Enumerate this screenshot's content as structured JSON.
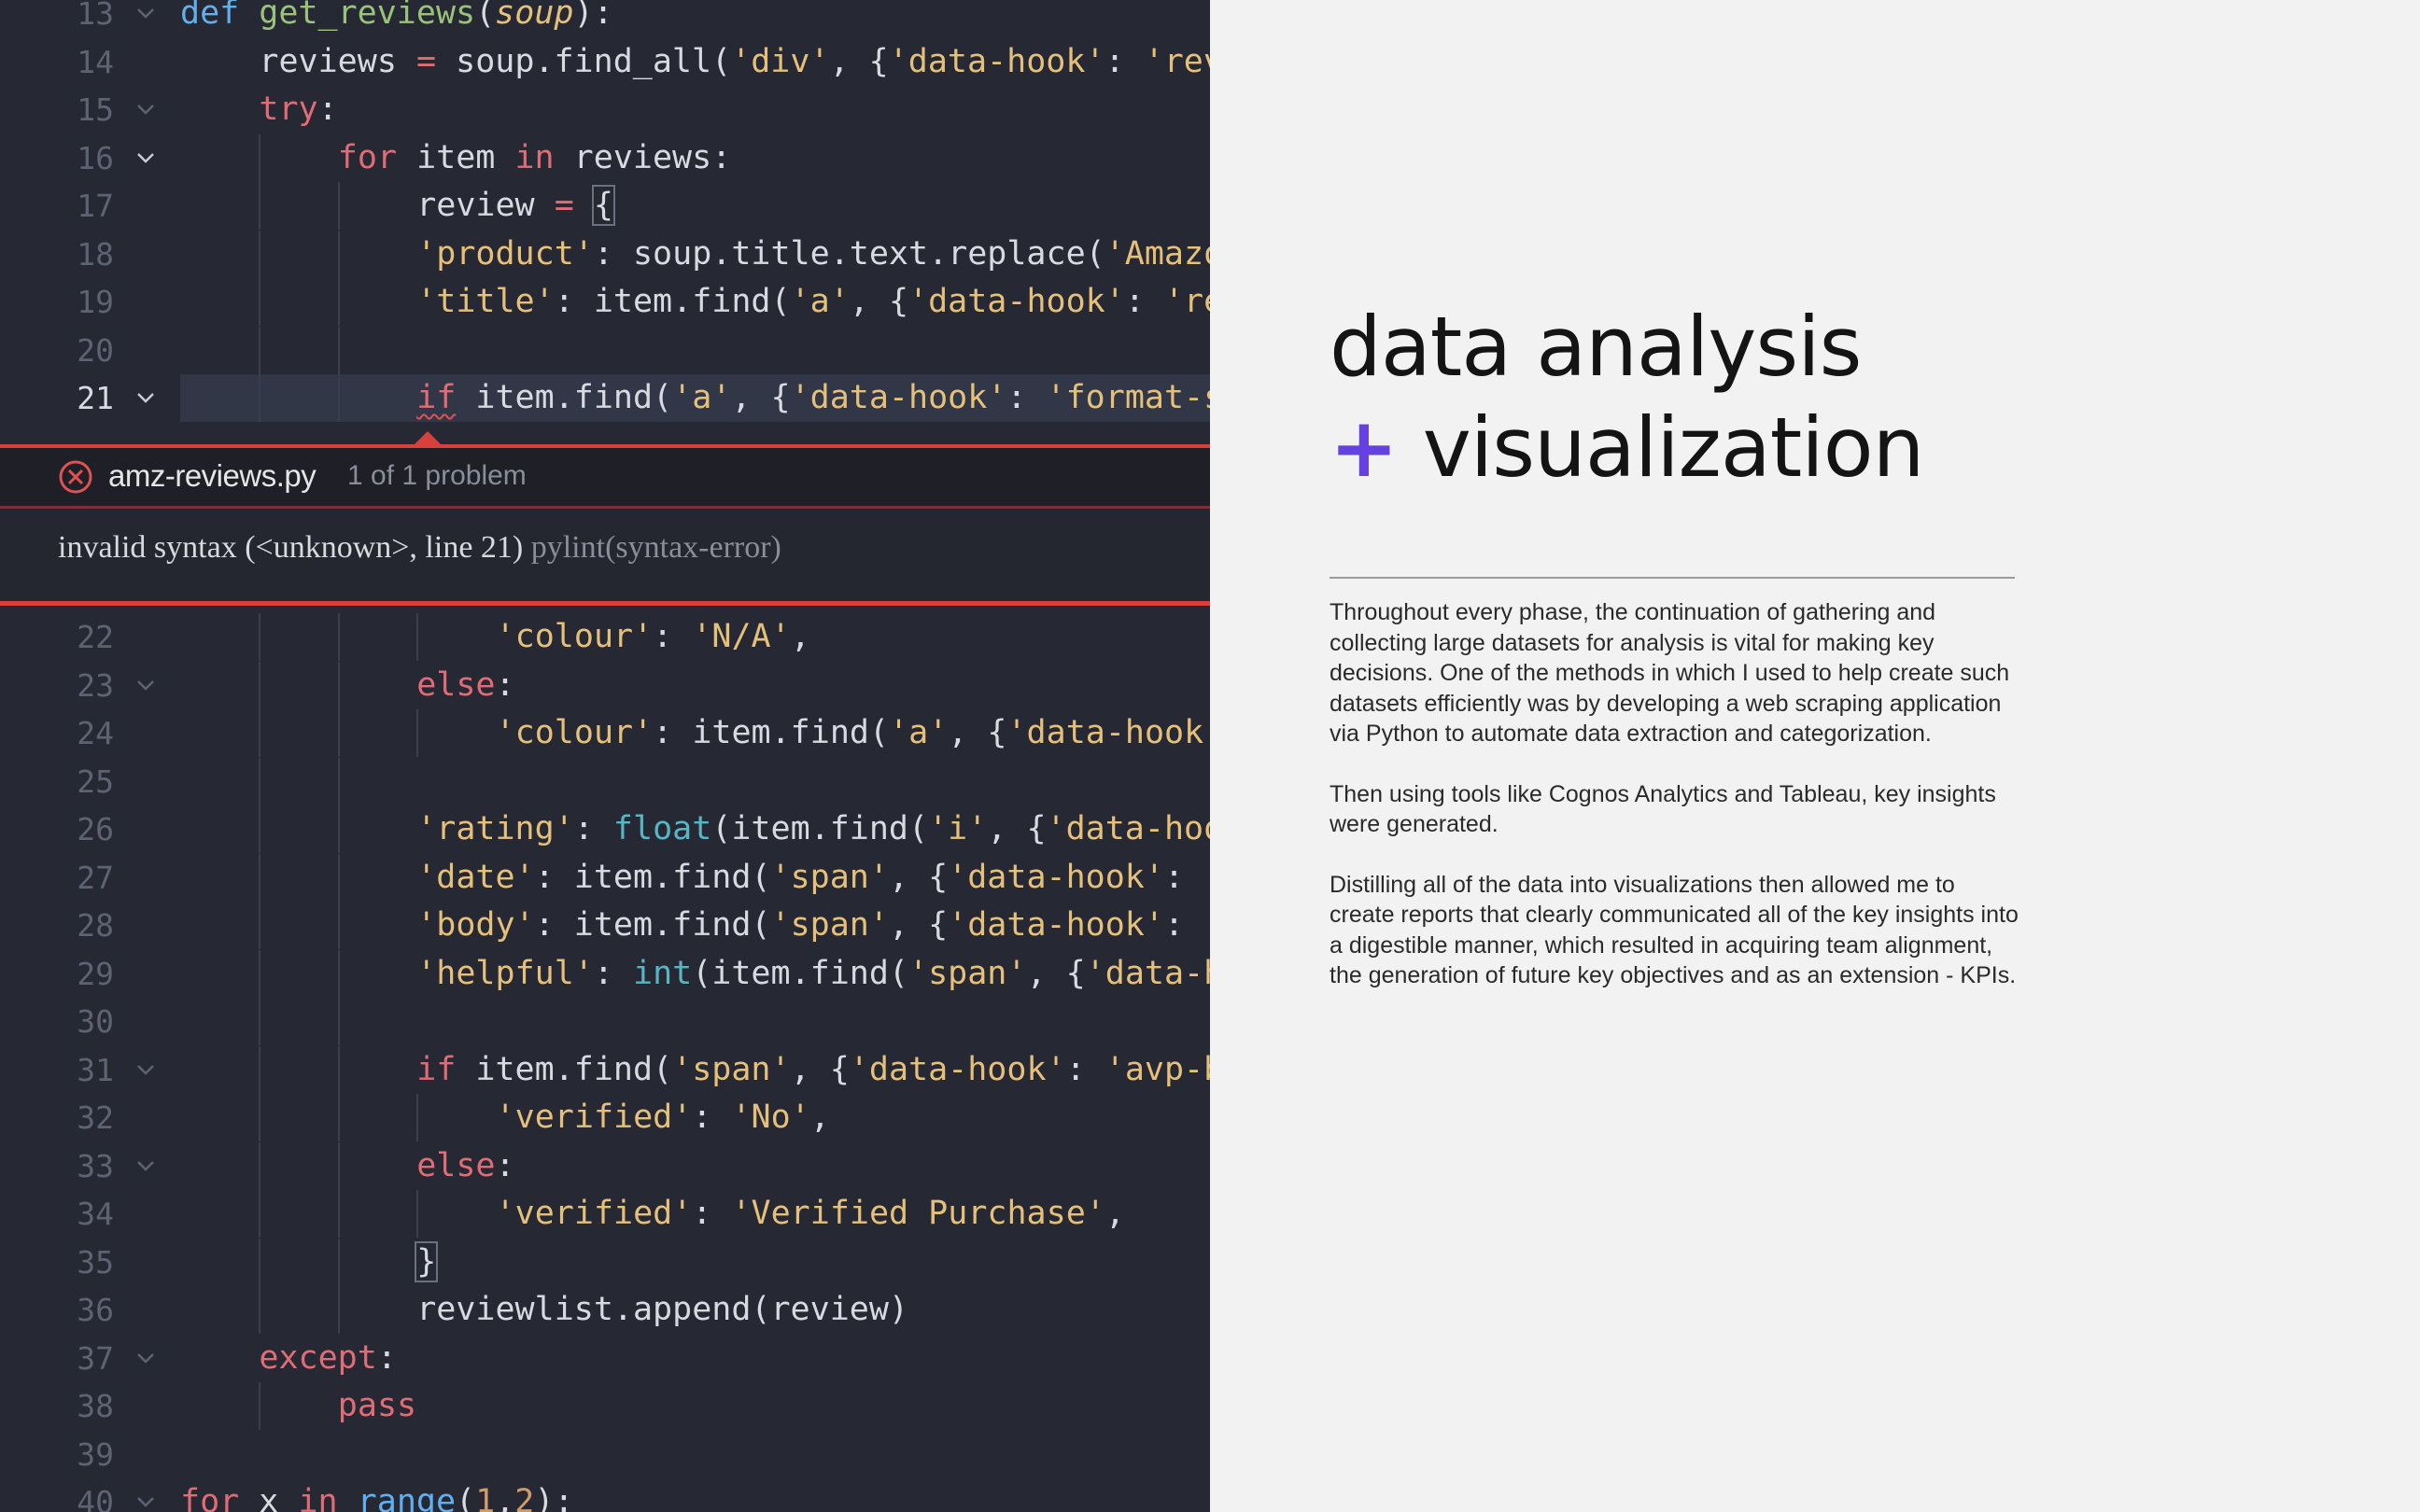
{
  "editor": {
    "lines_before": [
      {
        "n": "13",
        "fold": true,
        "indent": 0,
        "tokens": [
          [
            "kw-def",
            "def "
          ],
          [
            "fn",
            "get_reviews"
          ],
          [
            "pl",
            "("
          ],
          [
            "par",
            "soup"
          ],
          [
            "pl",
            "):"
          ]
        ]
      },
      {
        "n": "14",
        "fold": false,
        "indent": 1,
        "tokens": [
          [
            "pl",
            "reviews "
          ],
          [
            "op",
            "="
          ],
          [
            "pl",
            " soup.find_all("
          ],
          [
            "str",
            "'div'"
          ],
          [
            "pl",
            ", {"
          ],
          [
            "str",
            "'data-hook'"
          ],
          [
            "pl",
            ": "
          ],
          [
            "str",
            "'rev"
          ]
        ]
      },
      {
        "n": "15",
        "fold": true,
        "indent": 1,
        "tokens": [
          [
            "kw",
            "try"
          ],
          [
            "pl",
            ":"
          ]
        ]
      },
      {
        "n": "16",
        "fold": true,
        "indent": 2,
        "tokens": [
          [
            "kw",
            "for"
          ],
          [
            "pl",
            " item "
          ],
          [
            "kw",
            "in"
          ],
          [
            "pl",
            " reviews:"
          ]
        ]
      },
      {
        "n": "17",
        "fold": false,
        "indent": 3,
        "tokens": [
          [
            "pl",
            "review "
          ],
          [
            "op",
            "="
          ],
          [
            "pl",
            " "
          ],
          [
            "box",
            "{"
          ]
        ]
      },
      {
        "n": "18",
        "fold": false,
        "indent": 3,
        "tokens": [
          [
            "str",
            "'product'"
          ],
          [
            "pl",
            ": soup.title.text.replace("
          ],
          [
            "str",
            "'Amazo"
          ]
        ]
      },
      {
        "n": "19",
        "fold": false,
        "indent": 3,
        "tokens": [
          [
            "str",
            "'title'"
          ],
          [
            "pl",
            ": item.find("
          ],
          [
            "str",
            "'a'"
          ],
          [
            "pl",
            ", {"
          ],
          [
            "str",
            "'data-hook'"
          ],
          [
            "pl",
            ": "
          ],
          [
            "str",
            "'re"
          ]
        ]
      },
      {
        "n": "20",
        "fold": false,
        "indent": 3,
        "tokens": []
      },
      {
        "n": "21",
        "fold": true,
        "indent": 3,
        "current": true,
        "tokens": [
          [
            "squig",
            "if"
          ],
          [
            "pl",
            " item.find("
          ],
          [
            "str",
            "'a'"
          ],
          [
            "pl",
            ", {"
          ],
          [
            "str",
            "'data-hook'"
          ],
          [
            "pl",
            ": "
          ],
          [
            "str",
            "'format-s"
          ]
        ]
      }
    ],
    "lines_after": [
      {
        "n": "22",
        "fold": false,
        "indent": 4,
        "tokens": [
          [
            "str",
            "'colour'"
          ],
          [
            "pl",
            ": "
          ],
          [
            "str",
            "'N/A'"
          ],
          [
            "pl",
            ","
          ]
        ]
      },
      {
        "n": "23",
        "fold": true,
        "indent": 3,
        "tokens": [
          [
            "kw",
            "else"
          ],
          [
            "pl",
            ":"
          ]
        ]
      },
      {
        "n": "24",
        "fold": false,
        "indent": 4,
        "tokens": [
          [
            "str",
            "'colour'"
          ],
          [
            "pl",
            ": item.find("
          ],
          [
            "str",
            "'a'"
          ],
          [
            "pl",
            ", {"
          ],
          [
            "str",
            "'data-hook'"
          ]
        ]
      },
      {
        "n": "25",
        "fold": false,
        "indent": 3,
        "tokens": []
      },
      {
        "n": "26",
        "fold": false,
        "indent": 3,
        "tokens": [
          [
            "str",
            "'rating'"
          ],
          [
            "pl",
            ": "
          ],
          [
            "bi",
            "float"
          ],
          [
            "pl",
            "(item.find("
          ],
          [
            "str",
            "'i'"
          ],
          [
            "pl",
            ", {"
          ],
          [
            "str",
            "'data-hoo"
          ]
        ]
      },
      {
        "n": "27",
        "fold": false,
        "indent": 3,
        "tokens": [
          [
            "str",
            "'date'"
          ],
          [
            "pl",
            ": item.find("
          ],
          [
            "str",
            "'span'"
          ],
          [
            "pl",
            ", {"
          ],
          [
            "str",
            "'data-hook'"
          ],
          [
            "pl",
            ": "
          ],
          [
            "str",
            "'"
          ]
        ]
      },
      {
        "n": "28",
        "fold": false,
        "indent": 3,
        "tokens": [
          [
            "str",
            "'body'"
          ],
          [
            "pl",
            ": item.find("
          ],
          [
            "str",
            "'span'"
          ],
          [
            "pl",
            ", {"
          ],
          [
            "str",
            "'data-hook'"
          ],
          [
            "pl",
            ": "
          ],
          [
            "str",
            "'"
          ]
        ]
      },
      {
        "n": "29",
        "fold": false,
        "indent": 3,
        "tokens": [
          [
            "str",
            "'helpful'"
          ],
          [
            "pl",
            ": "
          ],
          [
            "bi",
            "int"
          ],
          [
            "pl",
            "(item.find("
          ],
          [
            "str",
            "'span'"
          ],
          [
            "pl",
            ", {"
          ],
          [
            "str",
            "'data-h"
          ]
        ]
      },
      {
        "n": "30",
        "fold": false,
        "indent": 3,
        "tokens": []
      },
      {
        "n": "31",
        "fold": true,
        "indent": 3,
        "tokens": [
          [
            "kw",
            "if"
          ],
          [
            "pl",
            " item.find("
          ],
          [
            "str",
            "'span'"
          ],
          [
            "pl",
            ", {"
          ],
          [
            "str",
            "'data-hook'"
          ],
          [
            "pl",
            ": "
          ],
          [
            "str",
            "'avp-b"
          ]
        ]
      },
      {
        "n": "32",
        "fold": false,
        "indent": 4,
        "tokens": [
          [
            "str",
            "'verified'"
          ],
          [
            "pl",
            ": "
          ],
          [
            "str",
            "'No'"
          ],
          [
            "pl",
            ","
          ]
        ]
      },
      {
        "n": "33",
        "fold": true,
        "indent": 3,
        "tokens": [
          [
            "kw",
            "else"
          ],
          [
            "pl",
            ":"
          ]
        ]
      },
      {
        "n": "34",
        "fold": false,
        "indent": 4,
        "tokens": [
          [
            "str",
            "'verified'"
          ],
          [
            "pl",
            ": "
          ],
          [
            "str",
            "'Verified Purchase'"
          ],
          [
            "pl",
            ","
          ]
        ]
      },
      {
        "n": "35",
        "fold": false,
        "indent": 3,
        "tokens": [
          [
            "box",
            "}"
          ]
        ]
      },
      {
        "n": "36",
        "fold": false,
        "indent": 3,
        "tokens": [
          [
            "pl",
            "reviewlist.append(review)"
          ]
        ]
      },
      {
        "n": "37",
        "fold": true,
        "indent": 1,
        "tokens": [
          [
            "kw",
            "except"
          ],
          [
            "pl",
            ":"
          ]
        ]
      },
      {
        "n": "38",
        "fold": false,
        "indent": 2,
        "tokens": [
          [
            "kw",
            "pass"
          ]
        ]
      },
      {
        "n": "39",
        "fold": false,
        "indent": 0,
        "tokens": []
      },
      {
        "n": "40",
        "fold": true,
        "indent": 0,
        "tokens": [
          [
            "kw",
            "for"
          ],
          [
            "pl",
            " x "
          ],
          [
            "kw",
            "in"
          ],
          [
            "pl",
            " "
          ],
          [
            "def",
            "range"
          ],
          [
            "pl",
            "("
          ],
          [
            "num",
            "1"
          ],
          [
            "pl",
            ","
          ],
          [
            "num",
            "2"
          ],
          [
            "pl",
            "):"
          ]
        ]
      }
    ]
  },
  "problem": {
    "file": "amz-reviews.py",
    "count": "1 of 1 problem",
    "message": "invalid syntax (<unknown>, line 21) ",
    "source": "pylint(syntax-error)"
  },
  "content": {
    "headline_line1": "data analysis",
    "headline_plus": "+",
    "headline_line2": " visualization",
    "paragraphs": [
      "Throughout every phase, the continuation of gathering and collecting large datasets for analysis is vital for making key decisions. One of the methods in which I used to help create such datasets efficiently was by developing a web scraping application via Python to automate data extraction and categorization.",
      "Then using tools like Cognos Analytics and Tableau, key insights were generated.",
      "Distilling all of the data into visualizations then allowed me to create reports that clearly communicated all of the key insights into a digestible manner, which resulted in acquiring team alignment, the generation of future key objectives and as an extension - KPIs."
    ]
  },
  "colors": {
    "accent": "#6441e0",
    "error": "#d8403b",
    "editor_bg": "#262833"
  },
  "icons": {
    "fold": "chevron-down-icon",
    "error": "error-circle-icon"
  }
}
